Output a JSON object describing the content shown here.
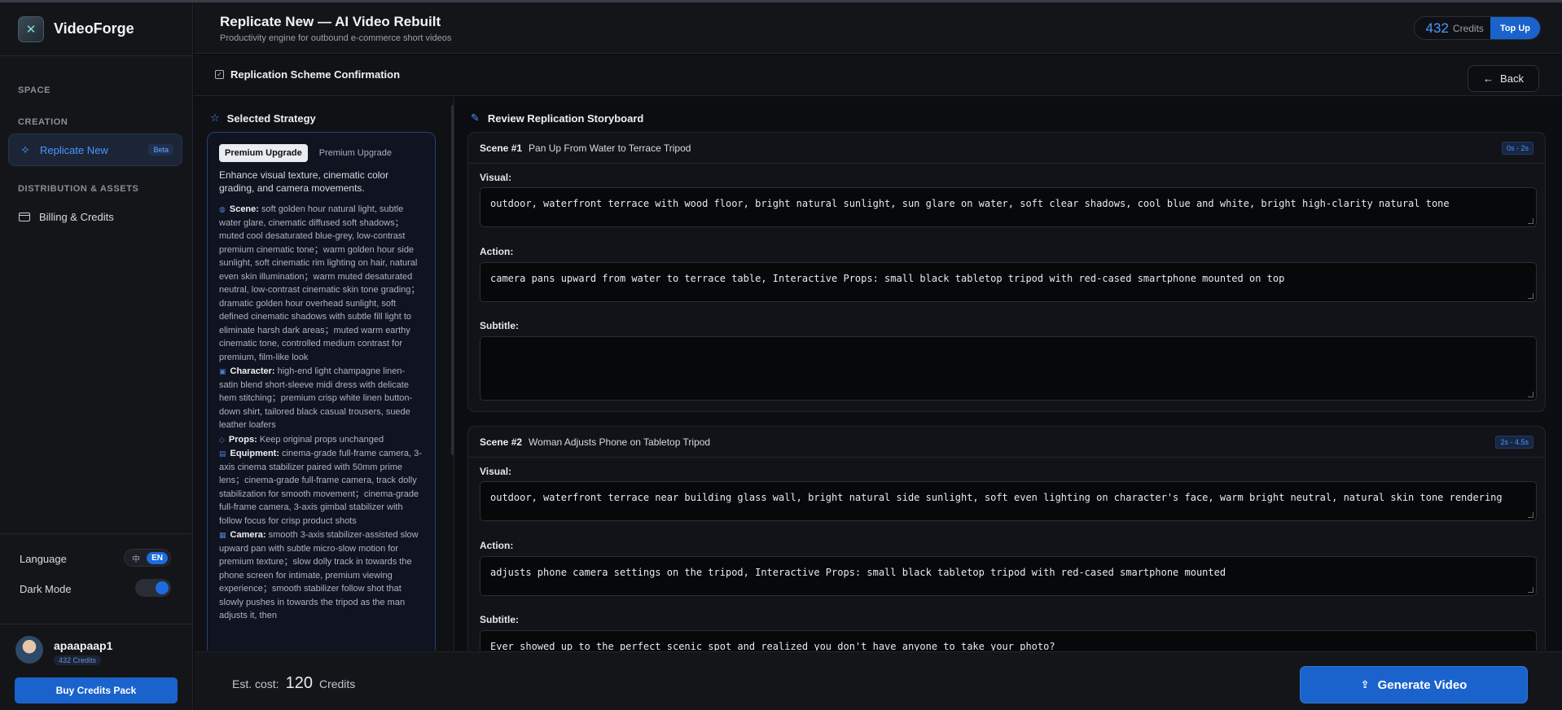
{
  "brand": {
    "name": "VideoForge",
    "logo_glyph": "✕"
  },
  "sidebar": {
    "section_space": "SPACE",
    "section_creation": "CREATION",
    "replicate_label": "Replicate New",
    "replicate_badge": "Beta",
    "section_distribution": "DISTRIBUTION & ASSETS",
    "billing_label": "Billing & Credits",
    "language_label": "Language",
    "language_alt": "中",
    "language_current": "EN",
    "dark_mode_label": "Dark Mode"
  },
  "user": {
    "name": "apaapaap1",
    "credits": "432 Credits",
    "buy_label": "Buy Credits Pack"
  },
  "header": {
    "title": "Replicate New — AI Video Rebuilt",
    "subtitle": "Productivity engine for outbound e-commerce short videos",
    "credits_value": "432",
    "credits_label": "Credits",
    "topup_label": "Top Up"
  },
  "subheader": {
    "title": "Replication Scheme Confirmation",
    "back_label": "Back"
  },
  "strategy": {
    "heading": "Selected Strategy",
    "tab_active": "Premium Upgrade",
    "tab_inactive": "Premium Upgrade",
    "description": "Enhance visual texture, cinematic color grading, and camera movements.",
    "details": [
      {
        "key": "Scene:",
        "text": "soft golden hour natural light, subtle water glare, cinematic diffused soft shadows；muted cool desaturated blue-grey, low-contrast premium cinematic tone；warm golden hour side sunlight, soft cinematic rim lighting on hair, natural even skin illumination；warm muted desaturated neutral, low-contrast cinematic skin tone grading；dramatic golden hour overhead sunlight, soft defined cinematic shadows with subtle fill light to eliminate harsh dark areas；muted warm earthy cinematic tone, controlled medium contrast for premium, film-like look"
      },
      {
        "key": "Character:",
        "text": "high-end light champagne linen-satin blend short-sleeve midi dress with delicate hem stitching；premium crisp white linen button-down shirt, tailored black casual trousers, suede leather loafers"
      },
      {
        "key": "Props:",
        "text": "Keep original props unchanged"
      },
      {
        "key": "Equipment:",
        "text": "cinema-grade full-frame camera, 3-axis cinema stabilizer paired with 50mm prime lens；cinema-grade full-frame camera, track dolly stabilization for smooth movement；cinema-grade full-frame camera, 3-axis gimbal stabilizer with follow focus for crisp product shots"
      },
      {
        "key": "Camera:",
        "text": "smooth 3-axis stabilizer-assisted slow upward pan with subtle micro-slow motion for premium texture；slow dolly track in towards the phone screen for intimate, premium viewing experience；smooth stabilizer follow shot that slowly pushes in towards the tripod as the man adjusts it, then"
      }
    ]
  },
  "storyboard": {
    "heading": "Review Replication Storyboard",
    "visual_label": "Visual:",
    "action_label": "Action:",
    "subtitle_label": "Subtitle:",
    "scenes": [
      {
        "num": "Scene #1",
        "title": "Pan Up From Water to Terrace Tripod",
        "time": "0s - 2s",
        "visual": "outdoor, waterfront terrace with wood floor, bright natural sunlight, sun glare on water, soft clear shadows, cool blue and white, bright high-clarity natural tone",
        "action": "camera pans upward from water to terrace table, Interactive Props: small black tabletop tripod with red-cased smartphone mounted on top",
        "subtitle": ""
      },
      {
        "num": "Scene #2",
        "title": "Woman Adjusts Phone on Tabletop Tripod",
        "time": "2s - 4.5s",
        "visual": "outdoor, waterfront terrace near building glass wall, bright natural side sunlight, soft even lighting on character's face, warm bright neutral, natural skin tone rendering",
        "action": "adjusts phone camera settings on the tripod, Interactive Props: small black tabletop tripod with red-cased smartphone mounted",
        "subtitle": "Ever showed up to the perfect scenic spot and realized you don't have anyone to take your photo?"
      }
    ]
  },
  "footer": {
    "est_label": "Est. cost:",
    "est_value": "120",
    "est_unit": "Credits",
    "generate_label": "Generate Video"
  },
  "colors": {
    "accent": "#1a63cc",
    "accent_text": "#4d95ff",
    "background": "#0b0c0f"
  }
}
